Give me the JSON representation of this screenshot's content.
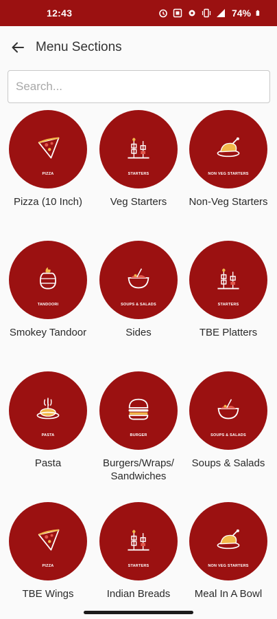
{
  "status_bar": {
    "time": "12:43",
    "battery": "74%",
    "icons": [
      "alarm-icon",
      "nfc-icon",
      "settings-icon",
      "vibrate-icon",
      "signal-icon",
      "battery-icon"
    ]
  },
  "app_bar": {
    "title": "Menu Sections",
    "back_icon": "arrow-back-icon"
  },
  "search": {
    "placeholder": "Search..."
  },
  "theme": {
    "brand": "#9b1111",
    "text": "#2a2a2a"
  },
  "sections": [
    {
      "label": "Pizza (10 Inch)",
      "caption": "PIZZA",
      "art": "pizza"
    },
    {
      "label": "Veg Starters",
      "caption": "STARTERS",
      "art": "skewers"
    },
    {
      "label": "Non-Veg Starters",
      "caption": "NON VEG STARTERS",
      "art": "chicken"
    },
    {
      "label": "Smokey Tandoor",
      "caption": "TANDOORI",
      "art": "tandoor"
    },
    {
      "label": "Sides",
      "caption": "SOUPS & SALADS",
      "art": "bowl"
    },
    {
      "label": "TBE Platters",
      "caption": "STARTERS",
      "art": "skewers"
    },
    {
      "label": "Pasta",
      "caption": "PASTA",
      "art": "pasta"
    },
    {
      "label": "Burgers/Wraps/ Sandwiches",
      "caption": "BURGER",
      "art": "burger"
    },
    {
      "label": "Soups & Salads",
      "caption": "SOUPS & SALADS",
      "art": "bowl"
    },
    {
      "label": "TBE Wings",
      "caption": "PIZZA",
      "art": "pizza"
    },
    {
      "label": "Indian Breads",
      "caption": "STARTERS",
      "art": "skewers"
    },
    {
      "label": "Meal In A Bowl",
      "caption": "NON VEG STARTERS",
      "art": "chicken"
    }
  ]
}
